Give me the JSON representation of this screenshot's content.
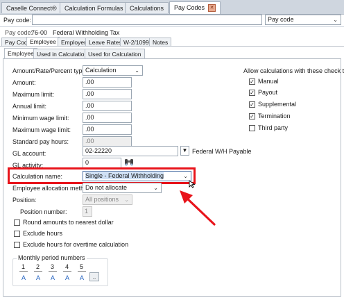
{
  "app_tabs": [
    {
      "label": "Caselle Connect®"
    },
    {
      "label": "Calculation Formulas"
    },
    {
      "label": "Calculations"
    },
    {
      "label": "Pay Codes"
    }
  ],
  "search": {
    "label": "Pay code:",
    "value": "",
    "type_value": "Pay code"
  },
  "header": {
    "paycode_label": "Pay code:",
    "paycode_value": "76-00",
    "paycode_desc": "Federal Withholding Tax"
  },
  "sub_tabs": [
    "Pay Code",
    "Employee",
    "Employer",
    "Leave Rates",
    "W-2/1099",
    "Notes"
  ],
  "inner_tabs": [
    "Employee",
    "Used in Calculations",
    "Used for Calculation"
  ],
  "form": {
    "amount_type_label": "Amount/Rate/Percent type:",
    "amount_type_value": "Calculation",
    "amount_label": "Amount:",
    "amount_value": ".00",
    "max_limit_label": "Maximum limit:",
    "max_limit_value": ".00",
    "annual_limit_label": "Annual limit:",
    "annual_limit_value": ".00",
    "min_wage_label": "Minimum wage limit:",
    "min_wage_value": ".00",
    "max_wage_label": "Maximum wage limit:",
    "max_wage_value": ".00",
    "std_hours_label": "Standard pay hours:",
    "std_hours_value": ".00",
    "gl_account_label": "GL account:",
    "gl_account_value": "02-22220",
    "gl_account_desc": "Federal W/H Payable",
    "gl_activity_label": "GL activity:",
    "gl_activity_value": "0",
    "calc_name_label": "Calculation name:",
    "calc_name_value": "Single - Federal Withholding",
    "alloc_label": "Employee allocation method:",
    "alloc_value": "Do not allocate",
    "position_label": "Position:",
    "position_value": "All positions",
    "position_number_label": "Position number:",
    "position_number_value": "1",
    "round_label": "Round amounts to nearest dollar",
    "exclude_hours_label": "Exclude hours",
    "exclude_ot_label": "Exclude hours for overtime calculation"
  },
  "check_types": {
    "title": "Allow calculations with these check types",
    "items": [
      {
        "label": "Manual",
        "checked": true
      },
      {
        "label": "Payout",
        "checked": true
      },
      {
        "label": "Supplemental",
        "checked": true
      },
      {
        "label": "Termination",
        "checked": true
      },
      {
        "label": "Third party",
        "checked": false
      }
    ]
  },
  "monthly": {
    "title": "Monthly period numbers",
    "numbers": [
      "1",
      "2",
      "3",
      "4",
      "5"
    ],
    "values": [
      "A",
      "A",
      "A",
      "A",
      "A"
    ],
    "more_label": ".."
  },
  "colors": {
    "highlight": "#e8141b",
    "arrow": "#e8141b",
    "link_blue": "#1f5fbf"
  }
}
